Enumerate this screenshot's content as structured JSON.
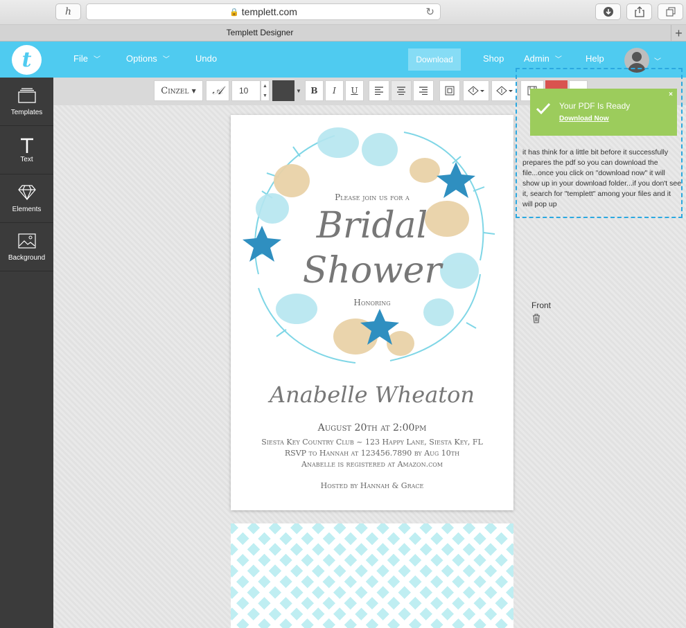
{
  "browser": {
    "url": "templett.com",
    "tab_title": "Templett Designer",
    "new_tab": "+"
  },
  "appbar": {
    "logo_letter": "t",
    "nav": {
      "file": "File",
      "options": "Options",
      "undo": "Undo",
      "download": "Download",
      "shop": "Shop",
      "admin": "Admin",
      "help": "Help"
    }
  },
  "sidebar": {
    "items": [
      {
        "label": "Templates",
        "icon": "templates-icon"
      },
      {
        "label": "Text",
        "icon": "text-icon"
      },
      {
        "label": "Elements",
        "icon": "diamond-icon"
      },
      {
        "label": "Background",
        "icon": "image-icon"
      }
    ]
  },
  "toolbar": {
    "font": "Cinzel",
    "font_size": "10",
    "text_color": "#454545",
    "bold": "B",
    "italic": "I",
    "underline": "U"
  },
  "card": {
    "join": "Please join us for a",
    "title1": "Bridal",
    "title2": "Shower",
    "honoring": "Honoring",
    "name": "Anabelle Wheaton",
    "date": "August 20th at 2:00pm",
    "location": "Siesta Key Country Club ~ 123 Happy Lane, Siesta Key, FL",
    "rsvp": "RSVP to Hannah at 123456.7890 by Aug 10th",
    "registry": "Anabelle is registered at Amazon.com",
    "hosted": "Hosted by Hannah & Grace"
  },
  "side_panel": {
    "front_label": "Front"
  },
  "toast": {
    "title": "Your PDF Is Ready",
    "link": "Download Now",
    "close": "×"
  },
  "annotation": {
    "note": "it has think for a little bit before it successfully prepares the pdf so you can download the file...once you click on \"download now\" it will show up in your download folder...if you don't see it, search for \"templett\" among your files and it will pop up"
  },
  "colors": {
    "brand": "#4fcbf0",
    "toast": "#9ccc5c",
    "annotation_border": "#2ba8e0"
  }
}
